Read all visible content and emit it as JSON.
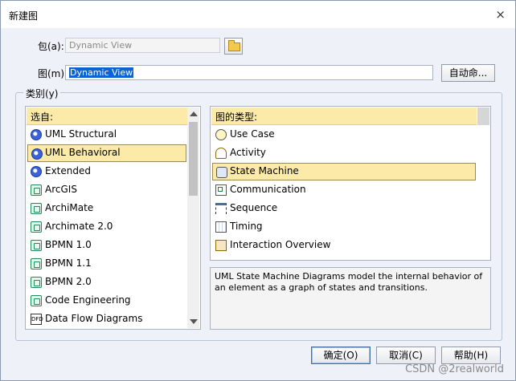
{
  "window": {
    "title": "新建图",
    "close_glyph": "×"
  },
  "package": {
    "label": "包(a):",
    "value": "Dynamic View"
  },
  "diagram": {
    "label": "图(m):",
    "value": "Dynamic View",
    "auto_button": "自动命..."
  },
  "category": {
    "label": "类别(y)",
    "from_header": "选自:",
    "from_items": [
      {
        "label": "UML Structural",
        "icon": "globe-icon"
      },
      {
        "label": "UML Behavioral",
        "icon": "globe-icon"
      },
      {
        "label": "Extended",
        "icon": "globe-icon"
      },
      {
        "label": "ArcGIS",
        "icon": "template-icon"
      },
      {
        "label": "ArchiMate",
        "icon": "template-icon"
      },
      {
        "label": "Archimate 2.0",
        "icon": "template-icon"
      },
      {
        "label": "BPMN 1.0",
        "icon": "template-icon"
      },
      {
        "label": "BPMN 1.1",
        "icon": "template-icon"
      },
      {
        "label": "BPMN 2.0",
        "icon": "template-icon"
      },
      {
        "label": "Code Engineering",
        "icon": "template-icon"
      },
      {
        "label": "Data Flow Diagrams",
        "icon": "dfd-icon"
      }
    ],
    "selected_from": "UML Behavioral",
    "type_header": "图的类型:",
    "type_items": [
      {
        "label": "Use Case",
        "icon": "use-case-icon"
      },
      {
        "label": "Activity",
        "icon": "activity-icon"
      },
      {
        "label": "State Machine",
        "icon": "state-machine-icon"
      },
      {
        "label": "Communication",
        "icon": "communication-icon"
      },
      {
        "label": "Sequence",
        "icon": "sequence-icon"
      },
      {
        "label": "Timing",
        "icon": "timing-icon"
      },
      {
        "label": "Interaction Overview",
        "icon": "interaction-overview-icon"
      }
    ],
    "selected_type": "State Machine",
    "description": "UML State Machine Diagrams model the internal behavior of an element as a graph of states and transitions."
  },
  "buttons": {
    "ok": "确定(O)",
    "cancel": "取消(C)",
    "help": "帮助(H)"
  },
  "watermark": "CSDN @2realworld",
  "colors": {
    "selection_bg": "#fbeaa8",
    "text_selection": "#0a64d6"
  }
}
